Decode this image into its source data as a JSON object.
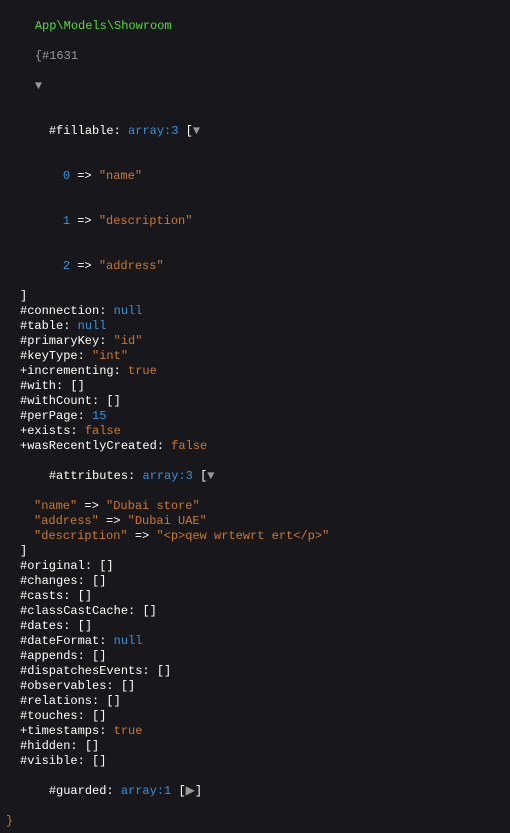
{
  "header": {
    "class": "App\\Models\\Showroom",
    "ref": "{#1631",
    "toggle_glyph": "▼"
  },
  "fillable": {
    "label": "#fillable",
    "type": "array:3",
    "open": "[",
    "toggle": "▼",
    "items": [
      {
        "idx": "0",
        "arrow": " => ",
        "value": "\"name\""
      },
      {
        "idx": "1",
        "arrow": " => ",
        "value": "\"description\""
      },
      {
        "idx": "2",
        "arrow": " => ",
        "value": "\"address\""
      }
    ],
    "close": "]"
  },
  "connection": {
    "label": "#connection",
    "value": "null",
    "kind": "null"
  },
  "table": {
    "label": "#table",
    "value": "null",
    "kind": "null"
  },
  "primaryKey": {
    "label": "#primaryKey",
    "value": "\"id\"",
    "kind": "string"
  },
  "keyType": {
    "label": "#keyType",
    "value": "\"int\"",
    "kind": "string"
  },
  "incrementing": {
    "label": "+incrementing",
    "value": "true",
    "kind": "bool"
  },
  "with": {
    "label": "#with",
    "value": "[]",
    "kind": "empty"
  },
  "withCount": {
    "label": "#withCount",
    "value": "[]",
    "kind": "empty"
  },
  "perPage": {
    "label": "#perPage",
    "value": "15",
    "kind": "num"
  },
  "exists": {
    "label": "+exists",
    "value": "false",
    "kind": "bool"
  },
  "wasRecentlyCreated": {
    "label": "+wasRecentlyCreated",
    "value": "false",
    "kind": "bool"
  },
  "attributes": {
    "label": "#attributes",
    "type": "array:3",
    "open": "[",
    "toggle": "▼",
    "items": [
      {
        "key": "\"name\"",
        "arrow": " => ",
        "value": "\"Dubai store\""
      },
      {
        "key": "\"address\"",
        "arrow": " => ",
        "value": "\"Dubai UAE\""
      },
      {
        "key": "\"description\"",
        "arrow": " => ",
        "value": "\"<p>qew wrtewrt ert</p>\""
      }
    ],
    "close": "]"
  },
  "original": {
    "label": "#original",
    "value": "[]",
    "kind": "empty"
  },
  "changes": {
    "label": "#changes",
    "value": "[]",
    "kind": "empty"
  },
  "casts": {
    "label": "#casts",
    "value": "[]",
    "kind": "empty"
  },
  "classCastCache": {
    "label": "#classCastCache",
    "value": "[]",
    "kind": "empty"
  },
  "dates": {
    "label": "#dates",
    "value": "[]",
    "kind": "empty"
  },
  "dateFormat": {
    "label": "#dateFormat",
    "value": "null",
    "kind": "null"
  },
  "appends": {
    "label": "#appends",
    "value": "[]",
    "kind": "empty"
  },
  "dispatchesEvents": {
    "label": "#dispatchesEvents",
    "value": "[]",
    "kind": "empty"
  },
  "observables": {
    "label": "#observables",
    "value": "[]",
    "kind": "empty"
  },
  "relations": {
    "label": "#relations",
    "value": "[]",
    "kind": "empty"
  },
  "touches": {
    "label": "#touches",
    "value": "[]",
    "kind": "empty"
  },
  "timestamps": {
    "label": "+timestamps",
    "value": "true",
    "kind": "bool"
  },
  "hidden": {
    "label": "#hidden",
    "value": "[]",
    "kind": "empty"
  },
  "visible": {
    "label": "#visible",
    "value": "[]",
    "kind": "empty"
  },
  "guarded": {
    "label": "#guarded",
    "type": "array:1",
    "open": "[",
    "toggle": "▶",
    "close": "]"
  },
  "outer_close": "}",
  "colon": ": "
}
